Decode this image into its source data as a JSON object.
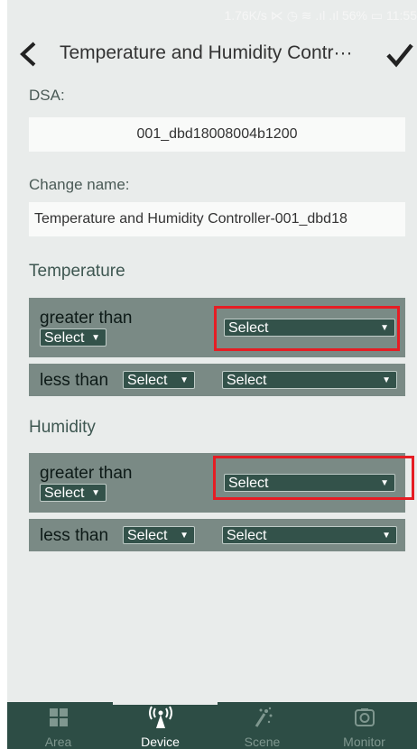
{
  "status_bar": {
    "text": "1.76K/s ⋉ ◷ ≋ .ıl .ıl 56% ▭ 11:55"
  },
  "header": {
    "title": "Temperature and Humidity Contr",
    "ellipsis": "···"
  },
  "dsa": {
    "label": "DSA:",
    "value": "001_dbd18008004b1200"
  },
  "change_name": {
    "label": "Change name:",
    "value": "Temperature and Humidity Controller-001_dbd18"
  },
  "temperature": {
    "title": "Temperature",
    "greater": {
      "label": "greater than",
      "op_select": "Select",
      "value_select": "Select"
    },
    "less": {
      "label": "less than",
      "op_select": "Select",
      "value_select": "Select"
    }
  },
  "humidity": {
    "title": "Humidity",
    "greater": {
      "label": "greater than",
      "op_select": "Select",
      "value_select": "Select"
    },
    "less": {
      "label": "less than",
      "op_select": "Select",
      "value_select": "Select"
    }
  },
  "tabs": [
    {
      "label": "Area",
      "icon": "grid-icon",
      "active": false
    },
    {
      "label": "Device",
      "icon": "antenna-icon",
      "active": true
    },
    {
      "label": "Scene",
      "icon": "scene-icon",
      "active": false
    },
    {
      "label": "Monitor",
      "icon": "camera-icon",
      "active": false
    }
  ],
  "colors": {
    "background": "#e9eceb",
    "row": "#7a8a85",
    "select": "#33524a",
    "tabbar": "#2d4d45",
    "highlight": "#e51d24"
  }
}
